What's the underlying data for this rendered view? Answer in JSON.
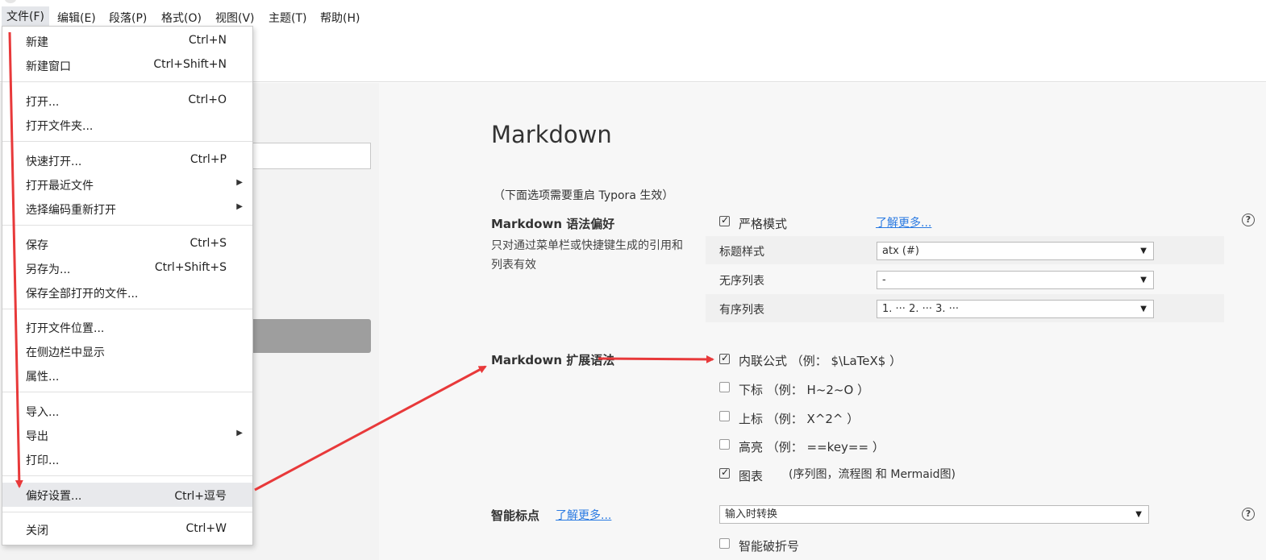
{
  "menubar": {
    "items": [
      "文件(F)",
      "编辑(E)",
      "段落(P)",
      "格式(O)",
      "视图(V)",
      "主题(T)",
      "帮助(H)"
    ]
  },
  "file_menu": {
    "items": [
      {
        "label": "新建",
        "shortcut": "Ctrl+N"
      },
      {
        "label": "新建窗口",
        "shortcut": "Ctrl+Shift+N"
      },
      {
        "label": "打开...",
        "shortcut": "Ctrl+O"
      },
      {
        "label": "打开文件夹...",
        "shortcut": ""
      },
      {
        "label": "快速打开...",
        "shortcut": "Ctrl+P"
      },
      {
        "label": "打开最近文件",
        "shortcut": ""
      },
      {
        "label": "选择编码重新打开",
        "shortcut": ""
      },
      {
        "label": "保存",
        "shortcut": "Ctrl+S"
      },
      {
        "label": "另存为...",
        "shortcut": "Ctrl+Shift+S"
      },
      {
        "label": "保存全部打开的文件...",
        "shortcut": ""
      },
      {
        "label": "打开文件位置...",
        "shortcut": ""
      },
      {
        "label": "在侧边栏中显示",
        "shortcut": ""
      },
      {
        "label": "属性...",
        "shortcut": ""
      },
      {
        "label": "导入...",
        "shortcut": ""
      },
      {
        "label": "导出",
        "shortcut": ""
      },
      {
        "label": "打印...",
        "shortcut": ""
      },
      {
        "label": "偏好设置...",
        "shortcut": "Ctrl+逗号"
      },
      {
        "label": "关闭",
        "shortcut": "Ctrl+W"
      }
    ]
  },
  "content": {
    "title": "Markdown",
    "note": "（下面选项需要重启 Typora 生效）",
    "syntax_pref": {
      "title": "Markdown 语法偏好",
      "desc": "只对通过菜单栏或快捷键生成的引用和列表有效",
      "strict_label": "严格模式",
      "learn_more": "了解更多...",
      "heading_label": "标题样式",
      "heading_value": "atx (#)",
      "ul_label": "无序列表",
      "ul_value": "-",
      "ol_label": "有序列表",
      "ol_value": "1. ··· 2. ··· 3. ···"
    },
    "extensions": {
      "title": "Markdown 扩展语法",
      "inline_math": "内联公式 （例： $\\LaTeX$ ）",
      "subscript": "下标 （例： H~2~O ）",
      "superscript": "上标 （例： X^2^ ）",
      "highlight": "高亮 （例： ==key== ）",
      "diagram": "图表",
      "diagram_note": "(序列图，流程图 和 Mermaid图)"
    },
    "smart_punct": {
      "title": "智能标点",
      "learn_more": "了解更多...",
      "value": "输入时转换",
      "smart_dash": "智能破折号"
    },
    "help_symbol": "?",
    "caret": "▼",
    "submenu_arrow": "▶"
  },
  "colors": {
    "arrow": "#e8393a",
    "link": "#2a7ae2",
    "highlight_item": "#e8e9ec"
  }
}
